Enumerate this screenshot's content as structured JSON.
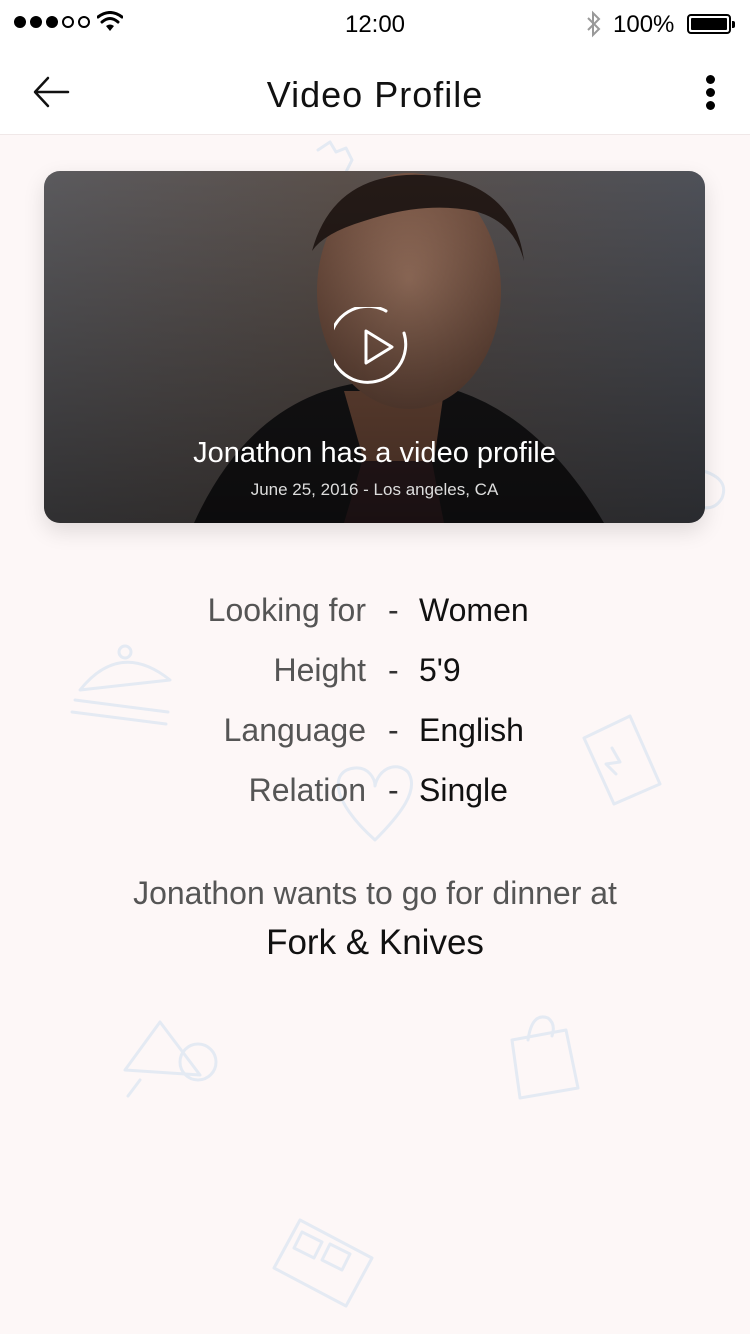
{
  "status_bar": {
    "time": "12:00",
    "battery": "100%"
  },
  "nav": {
    "title": "Video Profile",
    "back_icon": "arrow-left-icon",
    "more_icon": "more-vertical-icon"
  },
  "video": {
    "caption": "Jonathon has a video profile",
    "meta": "June 25, 2016 - Los angeles, CA",
    "play_icon": "play-circle-icon"
  },
  "details": [
    {
      "label": "Looking for",
      "dash": "-",
      "value": "Women"
    },
    {
      "label": "Height",
      "dash": "-",
      "value": "5'9"
    },
    {
      "label": "Language",
      "dash": "-",
      "value": "English"
    },
    {
      "label": "Relation",
      "dash": "-",
      "value": "Single"
    }
  ],
  "dinner": {
    "line": "Jonathon wants to go for dinner at",
    "place": "Fork & Knives"
  },
  "colors": {
    "background": "#fdf7f7",
    "doodle": "#e6ecf4"
  }
}
